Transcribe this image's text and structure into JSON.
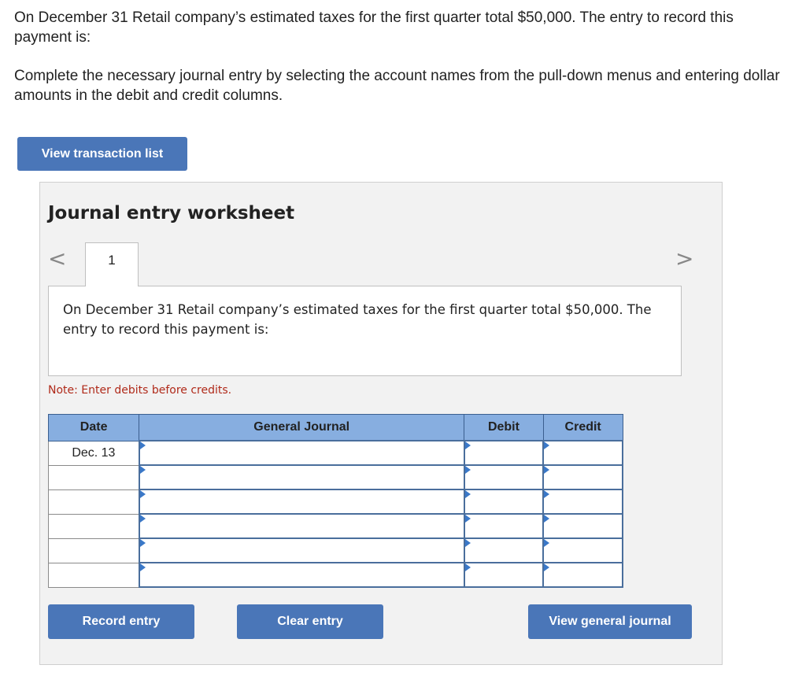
{
  "question": {
    "text": "On December 31 Retail company’s estimated taxes for the first quarter total $50,000. The entry to record this payment is:",
    "instructions": "Complete the necessary journal entry by selecting the account names from the pull-down menus and entering dollar amounts in the debit and credit columns."
  },
  "buttons": {
    "view_transactions": "View transaction list",
    "record_entry": "Record entry",
    "clear_entry": "Clear entry",
    "view_general_journal": "View general journal"
  },
  "worksheet": {
    "title": "Journal entry worksheet",
    "tab_number": "1",
    "prev_symbol": "<",
    "next_symbol": ">",
    "description": "On December 31 Retail company’s estimated taxes for the first quarter total $50,000. The entry to record this payment is:",
    "note": "Note: Enter debits before credits."
  },
  "journal": {
    "headers": {
      "date": "Date",
      "general_journal": "General Journal",
      "debit": "Debit",
      "credit": "Credit"
    },
    "rows": [
      {
        "date": "Dec. 13",
        "account": "",
        "debit": "",
        "credit": ""
      },
      {
        "date": "",
        "account": "",
        "debit": "",
        "credit": ""
      },
      {
        "date": "",
        "account": "",
        "debit": "",
        "credit": ""
      },
      {
        "date": "",
        "account": "",
        "debit": "",
        "credit": ""
      },
      {
        "date": "",
        "account": "",
        "debit": "",
        "credit": ""
      },
      {
        "date": "",
        "account": "",
        "debit": "",
        "credit": ""
      }
    ]
  },
  "colors": {
    "button_blue": "#4a76b8",
    "header_blue": "#87aee0",
    "note_red": "#b02a1a",
    "panel_gray": "#f2f2f2"
  }
}
